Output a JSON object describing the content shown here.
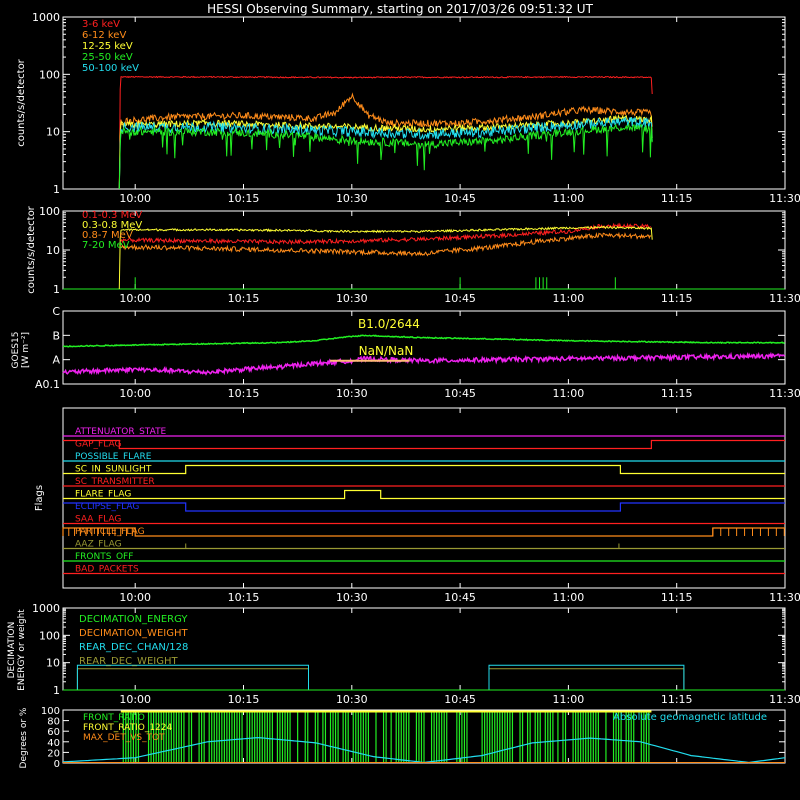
{
  "title": "HESSI Observing Summary, starting on 2017/03/26 09:51:32 UT",
  "colors": {
    "background": "#000000",
    "axes": "#ffffff",
    "red": "#ff2020",
    "orange": "#ff8c1a",
    "yellow": "#ffff33",
    "green": "#22ee22",
    "cyan": "#22ddee",
    "magenta": "#ee22ee",
    "blue": "#2233ff",
    "olive": "#999933",
    "peach": "#ffbb77"
  },
  "time_axis": {
    "start_min": 590,
    "end_min": 690,
    "tick_minutes": [
      600,
      615,
      630,
      645,
      660,
      675,
      690
    ],
    "tick_labels": [
      "10:00",
      "10:15",
      "10:30",
      "10:45",
      "11:00",
      "11:15",
      "11:30"
    ]
  },
  "panels": {
    "hxr": {
      "ylabel": "counts/s/detector",
      "ytick_labels": [
        "1",
        "10",
        "100",
        "1000"
      ],
      "legend": [
        "3-6 keV",
        "6-12 keV",
        "12-25 keV",
        "25-50 keV",
        "50-100 keV"
      ]
    },
    "gamma": {
      "ylabel": "counts/s/detector",
      "ytick_labels": [
        "1",
        "10",
        "100"
      ],
      "legend": [
        "0.1-0.3 MeV",
        "0.3-0.8 MeV",
        "0.8-7 MeV",
        "7-20 MeV"
      ]
    },
    "goes": {
      "ylabel_line1": "GOES15",
      "ylabel_line2": "[W m⁻²]",
      "ytick_labels": [
        "A0.1",
        "A",
        "B",
        "C"
      ],
      "annotation_top": "B1.0/2644",
      "annotation_mid": "NaN/NaN"
    },
    "flags": {
      "ylabel": "Flags",
      "labels": [
        "ATTENUATOR_STATE",
        "GAP_FLAG",
        "POSSIBLE_FLARE",
        "SC_IN_SUNLIGHT",
        "SC_TRANSMITTER",
        "FLARE_FLAG",
        "ECLIPSE_FLAG",
        "SAA_FLAG",
        "PARTICLE_FLAG",
        "AAZ_FLAG",
        "FRONTS_OFF",
        "BAD_PACKETS"
      ]
    },
    "decimation": {
      "ylabel_line1": "DECIMATION",
      "ylabel_line2": "ENERGY or weight",
      "ytick_labels": [
        "1",
        "10",
        "100",
        "1000"
      ],
      "legend": [
        "DECIMATION_ENERGY",
        "DECIMATION_WEIGHT",
        "REAR_DEC_CHAN/128",
        "REAR_DEC_WEIGHT"
      ]
    },
    "geo": {
      "ylabel": "Degrees or %",
      "ytick_labels": [
        "0",
        "20",
        "40",
        "60",
        "80",
        "100"
      ],
      "legend": [
        "FRONT_RATIO",
        "FRONT_RATIO_1224",
        "MAX_DET_VS_TOT"
      ],
      "right_label": "Absolute geomagnetic latitude"
    }
  },
  "chart_data": [
    {
      "type": "line",
      "title": "HESSI Observing Summary, starting on 2017/03/26 09:51:32 UT",
      "ylabel": "counts/s/detector",
      "yscale": "log",
      "ylim": [
        1,
        1000
      ],
      "x_units": "minutes since 00:00 UT",
      "xlim": [
        590,
        690
      ],
      "series": [
        {
          "name": "3-6 keV",
          "color": "red",
          "x": [
            597.8,
            598,
            610,
            620,
            630,
            640,
            650,
            660,
            670,
            671.5,
            671.7
          ],
          "y": [
            1,
            90,
            90,
            89,
            88,
            89,
            89,
            90,
            89,
            88,
            1
          ]
        },
        {
          "name": "6-12 keV",
          "color": "orange",
          "x": [
            597.8,
            598,
            605,
            615,
            625,
            628,
            630,
            632,
            635,
            645,
            655,
            662,
            668,
            671.5,
            671.7
          ],
          "y": [
            1,
            15,
            18,
            19,
            17,
            22,
            42,
            20,
            14,
            14,
            18,
            24,
            22,
            21,
            1
          ]
        },
        {
          "name": "12-25 keV",
          "color": "yellow",
          "x": [
            597.8,
            598,
            610,
            620,
            630,
            640,
            650,
            660,
            668,
            671.5,
            671.7
          ],
          "y": [
            1,
            13,
            14,
            13,
            12,
            11,
            12,
            14,
            17,
            16,
            1
          ]
        },
        {
          "name": "25-50 keV",
          "color": "green",
          "x": [
            597.8,
            598,
            610,
            620,
            630,
            640,
            650,
            660,
            668,
            671.5,
            671.7
          ],
          "y": [
            1,
            10,
            10,
            9,
            7,
            6,
            7,
            10,
            12,
            11,
            1
          ]
        },
        {
          "name": "50-100 keV",
          "color": "cyan",
          "x": [
            597.8,
            598,
            610,
            620,
            630,
            640,
            650,
            660,
            668,
            671.5,
            671.7
          ],
          "y": [
            1,
            12,
            12,
            11,
            10,
            9,
            10,
            13,
            15,
            14,
            1
          ]
        }
      ]
    },
    {
      "type": "line",
      "ylabel": "counts/s/detector",
      "yscale": "log",
      "ylim": [
        1,
        100
      ],
      "x_units": "minutes since 00:00 UT",
      "xlim": [
        590,
        690
      ],
      "series": [
        {
          "name": "0.1-0.3 MeV",
          "color": "red",
          "x": [
            598,
            610,
            620,
            630,
            640,
            650,
            660,
            665,
            671.5
          ],
          "y": [
            18,
            17,
            16,
            17,
            19,
            23,
            30,
            42,
            40
          ]
        },
        {
          "name": "0.3-0.8 MeV",
          "color": "yellow",
          "x": [
            597.8,
            598,
            610,
            620,
            630,
            640,
            650,
            660,
            665,
            671.5,
            671.7
          ],
          "y": [
            1,
            33,
            33,
            32,
            30,
            30,
            33,
            37,
            38,
            36,
            1
          ]
        },
        {
          "name": "0.8-7 MeV",
          "color": "orange",
          "x": [
            598,
            610,
            620,
            630,
            640,
            650,
            660,
            665,
            671.5
          ],
          "y": [
            12,
            11,
            10,
            9,
            8,
            12,
            20,
            24,
            22
          ]
        },
        {
          "name": "7-20 MeV",
          "color": "green",
          "x": [
            590,
            690
          ],
          "y": [
            1,
            1
          ]
        }
      ]
    },
    {
      "type": "line",
      "ylabel": "GOES15 [W m⁻²]",
      "yscale": "log",
      "ylim": [
        1e-09,
        1e-06
      ],
      "x_units": "minutes since 00:00 UT",
      "xlim": [
        590,
        690
      ],
      "series": [
        {
          "color": "green",
          "x": [
            590,
            600,
            610,
            620,
            625,
            630,
            632,
            635,
            640,
            650,
            660,
            670,
            680,
            690
          ],
          "y": [
            3.5e-08,
            4e-08,
            4.5e-08,
            5e-08,
            6e-08,
            9e-08,
            1e-07,
            9e-08,
            8e-08,
            7e-08,
            6e-08,
            5.5e-08,
            5e-08,
            5e-08
          ]
        },
        {
          "color": "magenta",
          "x": [
            590,
            600,
            610,
            620,
            630,
            632,
            635,
            640,
            650,
            660,
            670,
            680,
            690
          ],
          "y": [
            3e-09,
            4e-09,
            3e-09,
            5e-09,
            9e-09,
            1.1e-08,
            1e-08,
            9e-09,
            1e-08,
            1.1e-08,
            1.2e-08,
            1.3e-08,
            1.4e-08
          ]
        }
      ]
    },
    {
      "type": "line",
      "ylabel": "Flags",
      "x_units": "minutes since 00:00 UT",
      "xlim": [
        590,
        690
      ],
      "series": [
        {
          "name": "ATTENUATOR_STATE",
          "color": "magenta",
          "x": [
            590,
            690
          ],
          "y": [
            0,
            0
          ]
        },
        {
          "name": "GAP_FLAG",
          "color": "red",
          "x": [
            590,
            597.8,
            597.8,
            671.5,
            671.5,
            690
          ],
          "y": [
            1,
            1,
            0,
            0,
            1,
            1
          ]
        },
        {
          "name": "POSSIBLE_FLARE",
          "color": "cyan",
          "x": [
            590,
            690
          ],
          "y": [
            0,
            0
          ]
        },
        {
          "name": "SC_IN_SUNLIGHT",
          "color": "yellow",
          "x": [
            590,
            607,
            607,
            667.2,
            667.2,
            690
          ],
          "y": [
            0,
            0,
            1,
            1,
            0,
            0
          ]
        },
        {
          "name": "SC_TRANSMITTER",
          "color": "red",
          "x": [
            590,
            690
          ],
          "y": [
            0,
            0
          ]
        },
        {
          "name": "FLARE_FLAG",
          "color": "yellow",
          "x": [
            590,
            629,
            629,
            634,
            634,
            690
          ],
          "y": [
            0,
            0,
            1,
            1,
            0,
            0
          ]
        },
        {
          "name": "ECLIPSE_FLAG",
          "color": "blue",
          "x": [
            590,
            607,
            607,
            667.2,
            667.2,
            690
          ],
          "y": [
            1,
            1,
            0,
            0,
            1,
            1
          ]
        },
        {
          "name": "SAA_FLAG",
          "color": "red",
          "x": [
            590,
            690
          ],
          "y": [
            0,
            0
          ]
        },
        {
          "name": "PARTICLE_FLAG",
          "color": "orange",
          "x": [
            590,
            590,
            600,
            600,
            680,
            680,
            690
          ],
          "y": [
            0,
            1,
            1,
            0,
            0,
            1,
            1
          ]
        },
        {
          "name": "AAZ_FLAG",
          "color": "olive",
          "x": [
            590,
            690
          ],
          "y": [
            0,
            0
          ]
        },
        {
          "name": "FRONTS_OFF",
          "color": "green",
          "x": [
            590,
            690
          ],
          "y": [
            0,
            0
          ]
        },
        {
          "name": "BAD_PACKETS",
          "color": "red",
          "x": [
            590,
            690
          ],
          "y": [
            0,
            0
          ]
        }
      ]
    },
    {
      "type": "line",
      "ylabel": "DECIMATION ENERGY or weight",
      "yscale": "log",
      "ylim": [
        1,
        1000
      ],
      "x_units": "minutes since 00:00 UT",
      "xlim": [
        590,
        690
      ],
      "series": [
        {
          "name": "DECIMATION_ENERGY",
          "color": "green",
          "x": [
            590,
            690
          ],
          "y": [
            1,
            1
          ]
        },
        {
          "name": "DECIMATION_WEIGHT",
          "color": "orange",
          "x": [
            590,
            690
          ],
          "y": [
            1,
            1
          ]
        },
        {
          "name": "REAR_DEC_CHAN/128",
          "color": "cyan",
          "x": [
            590,
            592,
            592,
            624,
            624,
            649,
            649,
            676,
            676,
            690
          ],
          "y": [
            1,
            1,
            8,
            8,
            1,
            1,
            8,
            8,
            1,
            1
          ]
        },
        {
          "name": "REAR_DEC_WEIGHT",
          "color": "olive",
          "x": [
            590,
            592,
            592,
            624,
            624,
            649,
            649,
            676,
            676,
            690
          ],
          "y": [
            1,
            1,
            6,
            6,
            1,
            1,
            6,
            6,
            1,
            1
          ]
        }
      ]
    },
    {
      "type": "line",
      "ylabel": "Degrees or %",
      "ylim": [
        0,
        100
      ],
      "x_units": "minutes since 00:00 UT",
      "xlim": [
        590,
        690
      ],
      "series": [
        {
          "name": "FRONT_RATIO",
          "color": "green",
          "x": [
            598,
            671.5
          ],
          "y": [
            100,
            100
          ]
        },
        {
          "name": "FRONT_RATIO_1224",
          "color": "yellow",
          "x": [
            598,
            671.5
          ],
          "y": [
            100,
            100
          ]
        },
        {
          "name": "MAX_DET_VS_TOT",
          "color": "orange",
          "x": [
            590,
            690
          ],
          "y": [
            0,
            0
          ]
        },
        {
          "name": "Absolute geomagnetic latitude",
          "color": "cyan",
          "x": [
            590,
            600,
            610,
            617,
            625,
            633,
            640,
            648,
            655,
            663,
            670,
            677,
            685,
            690
          ],
          "y": [
            2,
            10,
            40,
            48,
            38,
            12,
            1,
            14,
            38,
            47,
            40,
            14,
            1,
            10
          ]
        }
      ]
    }
  ]
}
